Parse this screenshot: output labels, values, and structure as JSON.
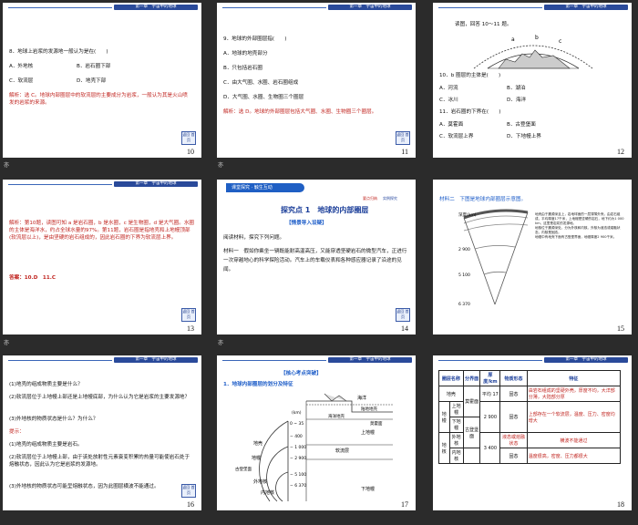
{
  "header_text": "第一章　宇宙中的地球",
  "nav_btn": "返回\n首页",
  "below": [
    "亦",
    "亦",
    "亦",
    "亦"
  ],
  "s10": {
    "num": "10",
    "q": "8．地球上岩浆的发源地一般认为是在(　　)",
    "a": "A．外地核",
    "b": "B．岩石圈下部",
    "c": "C．软流层",
    "d": "D．地壳下部",
    "exp": "解析：选 C。地球内部圈层中的软流层的主要成分为岩浆，一般认为其是火山喷发的岩浆的来源。"
  },
  "s11": {
    "num": "11",
    "q": "9．地球的外部圈层指(　　)",
    "a": "A．地球的地壳部分",
    "b": "B．只包括岩石圈",
    "c": "C．由大气圈、水圈、岩石圈组成",
    "d": "D．大气圈、水圈、生物圈三个圈层",
    "exp": "解析：选 D。地球的外部圈层包括大气圈、水圈、生物圈三个圈层。"
  },
  "s12": {
    "num": "12",
    "intro": "读图，回答 10～11 题。",
    "labels": [
      "a",
      "b",
      "c"
    ],
    "q10": "10．b 圈层的主体是(　　)",
    "q10a": "A．河流",
    "q10b": "B．湖泊",
    "q10c": "C．冰川",
    "q10d": "D．海洋",
    "q11": "11．岩石圈的下界在(　　)",
    "q11a": "A．莫霍面",
    "q11b": "B．古登堡面",
    "q11c": "C．软流层上界",
    "q11d": "D．下地幔上界"
  },
  "s13": {
    "num": "13",
    "exp": "解析：第10题，读图可知 a 是岩石圈，b 是水圈，c 是生物圈，d 是大气圈。水圈的主体是海洋水，约占全球水量的97%。第11题，岩石圈是指地壳和上地幔顶部(软流层以上)，是由坚硬的岩石组成的，因此岩石圈的下界为软流层上界。",
    "ans": "答案：10.D　11.C"
  },
  "s14": {
    "num": "14",
    "banner": "课堂探究 · 触生互动",
    "point": "探究点 1　地球的内部圈层",
    "link1": "要点归纳",
    "link2": "实例探究",
    "tag": "【情景导入设疑】",
    "read": "阅读材料，探究下列问题。",
    "m1": "材料一　假如你乘坐一辆既能耐高温高压，又能穿透坚硬岩石的微型汽车，正进行一次穿越地心的科学探险活动。汽车上的车载仪表和各种感应器记录了沿途的见闻。"
  },
  "s15": {
    "num": "15",
    "m2": "材料二　下图是地球内部圈层示意图。",
    "depth_label": "深度(km)",
    "ticks": [
      "2 900",
      "5 100",
      "6 370"
    ],
    "notes": "地壳由于震源深且上，岩地球面的一层薄薄外壳，由岩石组成，平均厚度17千米，上地幔是坚硬的岩石，地下约为1 000 km，这里是岩浆的发源地。\n地核位于震源深处，分为外核和内核。外核为液态或熔融状态，内核是固态。\n地幔中有地壳下面有古登堡界面，地幔厚度2 900千米。"
  },
  "s16": {
    "num": "16",
    "q1": "(1)地壳的组成物质主要是什么？",
    "q2": "(2)软流层位于上地幔上部还是上地幔底部，为什么认为它是岩浆的主要发源地？",
    "q3": "(3)外地核的物质状态是什么？为什么？",
    "tip": "提示：",
    "a1": "(1)地壳的组成物质主要是岩石。",
    "a2": "(2)软流层位于上地幔上部，由于该处放射性元素衰变积累的热量可能使岩石处于熔融状态，因此认为它是岩浆的发源地。",
    "a3": "(3)外地核的物质状态可能呈熔融状态，因为此圈层横波不能通过。"
  },
  "s17": {
    "num": "17",
    "tag": "【核心考点突破】",
    "heading": "1．地球内部圈层的划分及特征",
    "labels": {
      "crust": "地壳",
      "mantle": "地幔",
      "outer_core": "外地核",
      "inner_core": "内地核",
      "ocean": "海洋",
      "continental": "陆地地壳",
      "oceanic": "海洋地壳",
      "moho": "莫霍面",
      "gutenberg": "古登堡面",
      "upper_mantle": "上地幔",
      "asthenosphere": "软流层",
      "lower_mantle": "下地幔",
      "km": "(km)"
    },
    "depths": [
      "0 ~ 35",
      "− 400",
      "− 1 000",
      "− 2 900",
      "− 5 100",
      "− 6 370"
    ]
  },
  "s18": {
    "num": "18",
    "headers": [
      "圈层名称",
      "分界面",
      "厚度/km",
      "物质形态",
      "特征"
    ],
    "rows": [
      [
        "地壳",
        "",
        "平均 17",
        "固态",
        "由岩石组成的坚硬外壳，厚度不均，大洋部分薄，大陆部分厚"
      ],
      [
        "上地幔",
        "莫霍面",
        "",
        "固态",
        "上部存在一个软流层，温度、压力、密度均增大"
      ],
      [
        "下地幔",
        "",
        "2 900",
        "",
        ""
      ],
      [
        "外地核",
        "古登堡面",
        "3 400",
        "液态或熔融状态",
        "横波不能通过"
      ],
      [
        "内地核",
        "",
        "",
        "固态",
        "温度很高，密度、压力都很大"
      ]
    ],
    "side_mantle": "地幔",
    "side_core": "地核"
  }
}
